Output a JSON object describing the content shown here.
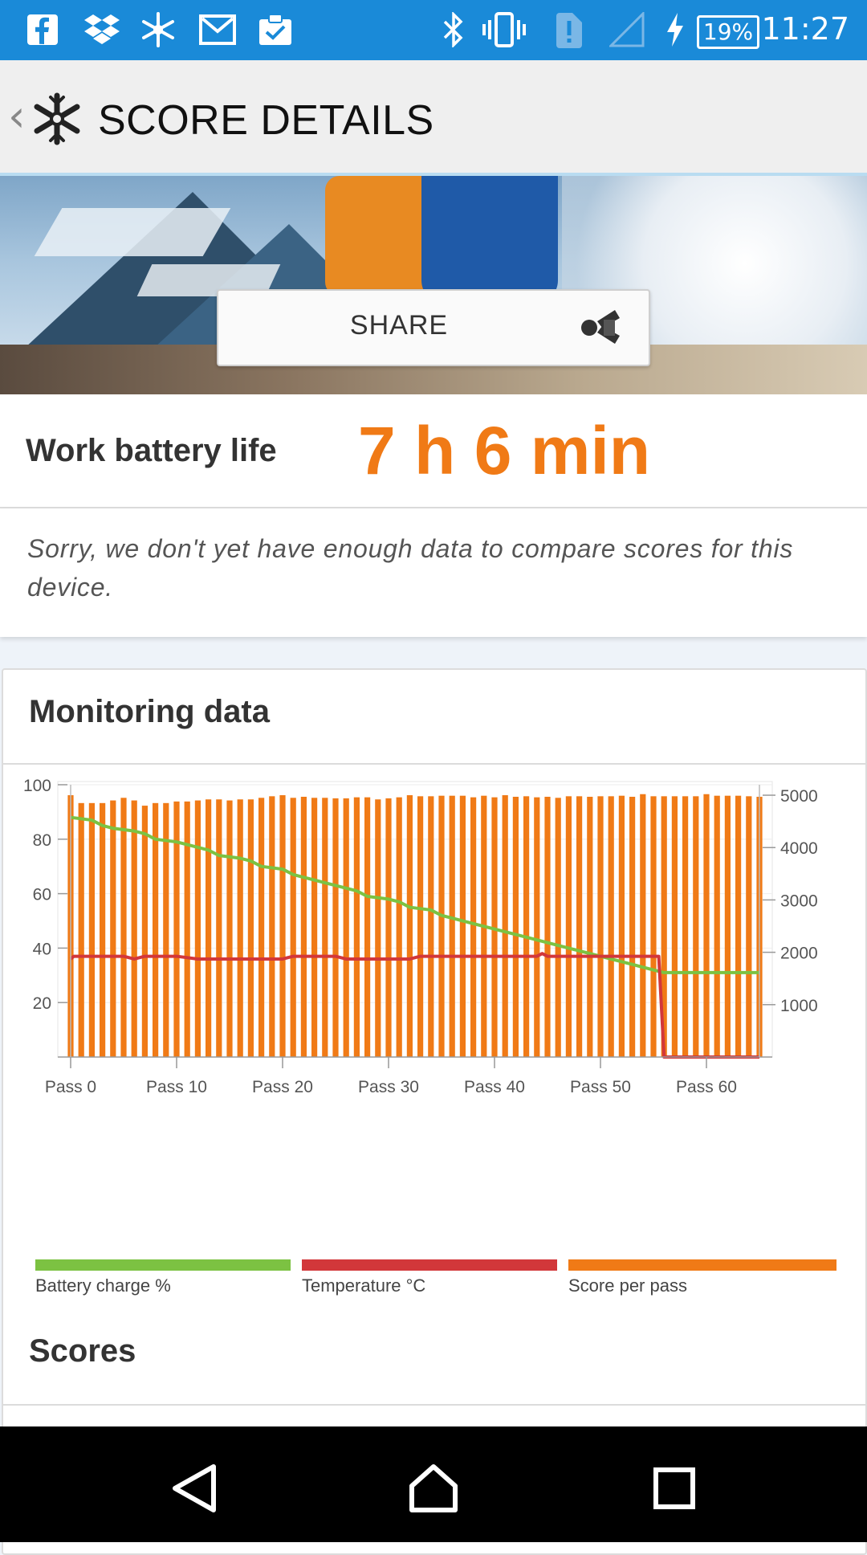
{
  "status_bar": {
    "time": "11:27",
    "battery_percent": "19%",
    "icons": [
      "facebook-icon",
      "dropbox-icon",
      "snowflake-icon",
      "gmail-icon",
      "clipboard-check-icon",
      "bluetooth-icon",
      "vibrate-icon",
      "sim-alert-icon",
      "signal-icon",
      "charging-icon",
      "battery-icon"
    ]
  },
  "app_bar": {
    "title": "SCORE DETAILS",
    "back_icon": "chevron-left-icon",
    "logo_icon": "snowflake-logo-icon"
  },
  "hero": {
    "share_label": "SHARE",
    "share_icon": "share-icon"
  },
  "result": {
    "label": "Work battery life",
    "value": "7 h 6 min",
    "value_color": "#f07a16"
  },
  "note": {
    "text": "Sorry, we don't yet have enough data to compare scores for this device."
  },
  "monitoring": {
    "title": "Monitoring data",
    "legend": [
      {
        "label": "Battery charge %",
        "color": "#7cc242"
      },
      {
        "label": "Temperature °C",
        "color": "#d2373a"
      },
      {
        "label": "Score per pass",
        "color": "#f07a16"
      }
    ]
  },
  "chart_data": {
    "type": "bar",
    "x_tick_labels": [
      "Pass 0",
      "Pass 10",
      "Pass 20",
      "Pass 30",
      "Pass 40",
      "Pass 50",
      "Pass 60"
    ],
    "xlim": [
      0,
      65
    ],
    "left_axis": {
      "ticks": [
        "20",
        "40",
        "60",
        "80",
        "100"
      ],
      "ylim": [
        0,
        100
      ]
    },
    "right_axis": {
      "ticks": [
        "1000",
        "2000",
        "3000",
        "4000",
        "5000"
      ],
      "ylim": [
        0,
        5200
      ]
    },
    "grid": true,
    "series": [
      {
        "name": "Score per pass",
        "type": "bar",
        "axis": "right",
        "color": "#f07a16",
        "values": [
          5000,
          4850,
          4850,
          4850,
          4900,
          4950,
          4900,
          4800,
          4850,
          4850,
          4880,
          4880,
          4900,
          4920,
          4920,
          4900,
          4920,
          4920,
          4950,
          4980,
          5000,
          4950,
          4970,
          4950,
          4950,
          4940,
          4940,
          4960,
          4960,
          4920,
          4940,
          4960,
          5000,
          4980,
          4980,
          4990,
          4990,
          4990,
          4960,
          4990,
          4960,
          5000,
          4970,
          4980,
          4960,
          4970,
          4950,
          4980,
          4980,
          4970,
          4980,
          4980,
          4990,
          4970,
          5020,
          4980,
          4980,
          4980,
          4980,
          4980,
          5020,
          4990,
          4990,
          4990,
          4980,
          4970
        ]
      },
      {
        "name": "Battery charge %",
        "type": "line",
        "axis": "left",
        "color": "#7cc242",
        "x": [
          0,
          2,
          3,
          4,
          6,
          7,
          8,
          10,
          12,
          13,
          14,
          16,
          17,
          18,
          20,
          21,
          22,
          24,
          26,
          27,
          28,
          30,
          31,
          32,
          34,
          35,
          36,
          38,
          40,
          42,
          43,
          44,
          46,
          48,
          50,
          52,
          53,
          54,
          55,
          56,
          60,
          65
        ],
        "values": [
          88,
          87,
          85,
          84,
          83,
          82,
          80,
          79,
          77,
          76,
          74,
          73,
          72,
          70,
          69,
          67,
          66,
          64,
          62,
          61,
          59,
          58,
          57,
          55,
          54,
          52,
          51,
          49,
          47,
          45,
          44,
          43,
          41,
          39,
          37,
          35,
          34,
          33,
          32,
          31,
          31,
          31
        ]
      },
      {
        "name": "Temperature °C",
        "type": "line",
        "axis": "left",
        "color": "#d2373a",
        "x": [
          0,
          0.3,
          5,
          6,
          7,
          10,
          12,
          13,
          20,
          21,
          25,
          26,
          32,
          33,
          44,
          44.5,
          45,
          55,
          55.5,
          56,
          65
        ],
        "values": [
          36,
          37,
          37,
          36,
          37,
          37,
          36,
          36,
          36,
          37,
          37,
          36,
          36,
          37,
          37,
          38,
          37,
          37,
          37,
          0,
          0
        ]
      }
    ]
  },
  "scores": {
    "title": "Scores"
  },
  "nav_bar": {
    "back_icon": "triangle-back-icon",
    "home_icon": "home-icon",
    "recents_icon": "square-recents-icon"
  }
}
